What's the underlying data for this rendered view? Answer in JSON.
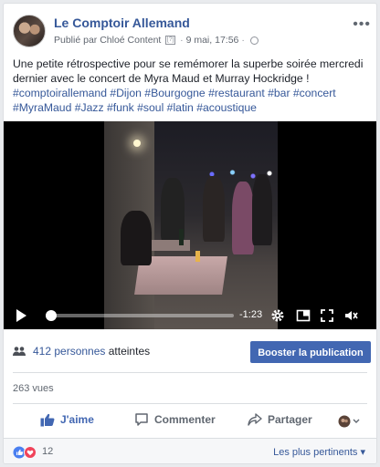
{
  "post": {
    "page_name": "Le Comptoir Allemand",
    "published_by": "Publié par Chloé Content",
    "help_marker": "[?]",
    "date": "9 mai, 17:56",
    "text": "Une petite rétrospective pour se remémorer la superbe soirée mercredi dernier avec le concert de Myra Maud et Murray Hockridge !",
    "hashtags": "#comptoirallemand #Dijon #Bourgogne #restaurant #bar #concert #MyraMaud #Jazz #funk #soul #latin #acoustique"
  },
  "video": {
    "time_remaining": "-1:23",
    "progress_fraction": 0.03
  },
  "stats": {
    "reach_count": "412 personnes",
    "reach_suffix": "atteintes",
    "boost_label": "Booster la publication",
    "views": "263 vues"
  },
  "actions": {
    "like": "J'aime",
    "comment": "Commenter",
    "share": "Partager"
  },
  "reactions": {
    "count": "12",
    "sort_label": "Les plus pertinents ▾"
  },
  "colors": {
    "link": "#365899",
    "accent": "#4267b2"
  },
  "icons": [
    "more-icon",
    "globe-icon",
    "play-icon",
    "gear-icon",
    "pip-icon",
    "fullscreen-icon",
    "volume-icon",
    "people-icon",
    "like-icon",
    "comment-icon",
    "share-icon",
    "audience-icon",
    "love-reaction-icon"
  ]
}
